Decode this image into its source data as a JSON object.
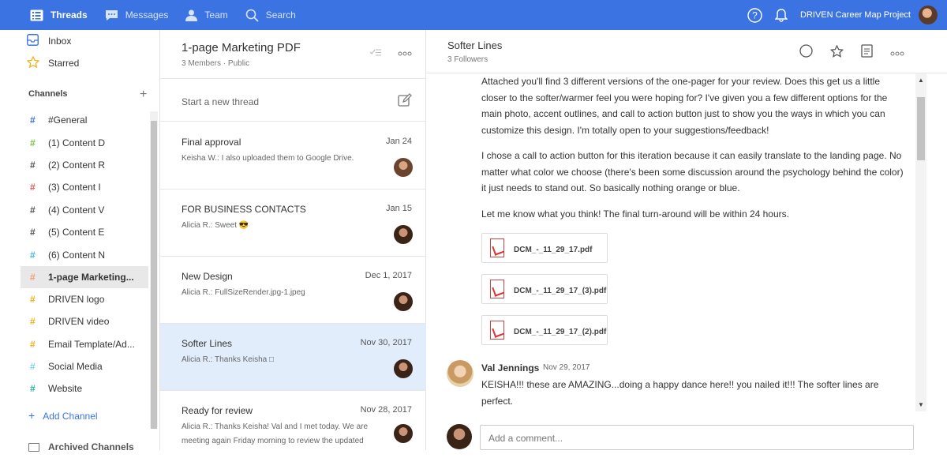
{
  "topbar": {
    "nav": [
      {
        "label": "Threads",
        "icon": "threads-icon"
      },
      {
        "label": "Messages",
        "icon": "messages-icon"
      },
      {
        "label": "Team",
        "icon": "team-icon"
      },
      {
        "label": "Search",
        "icon": "search-icon"
      }
    ],
    "project": "DRIVEN Career Map Project",
    "accent": "#3c73e2"
  },
  "sidebar": {
    "inbox": "Inbox",
    "starred": "Starred",
    "channels_heading": "Channels",
    "channels": [
      {
        "name": "#General",
        "color": "#3c73e2"
      },
      {
        "name": "(1) Content D",
        "color": "#7cc43c"
      },
      {
        "name": "(2) Content R",
        "color": "#555555"
      },
      {
        "name": "(3) Content I",
        "color": "#e05a5a"
      },
      {
        "name": "(4) Content V",
        "color": "#555555"
      },
      {
        "name": "(5) Content E",
        "color": "#555555"
      },
      {
        "name": "(6) Content N",
        "color": "#45b7e8"
      },
      {
        "name": "1-page Marketing...",
        "color": "#f0a070"
      },
      {
        "name": "DRIVEN logo",
        "color": "#f1b21b"
      },
      {
        "name": "DRIVEN video",
        "color": "#f1b21b"
      },
      {
        "name": "Email Template/Ad...",
        "color": "#f1b21b"
      },
      {
        "name": "Social Media",
        "color": "#7fd0ea"
      },
      {
        "name": "Website",
        "color": "#2bb3a0"
      }
    ],
    "add_channel": "Add Channel",
    "archived": "Archived Channels"
  },
  "threads": {
    "title": "1-page Marketing PDF",
    "subtitle": "3 Members · Public",
    "new_thread_placeholder": "Start a new thread",
    "items": [
      {
        "title": "Final approval",
        "date": "Jan 24",
        "preview": "Keisha W.: I also uploaded them to Google Drive."
      },
      {
        "title": "FOR BUSINESS CONTACTS",
        "date": "Jan 15",
        "preview": "Alicia R.: Sweet 😎"
      },
      {
        "title": "New Design",
        "date": "Dec 1, 2017",
        "preview": "Alicia R.: FullSizeRender.jpg-1.jpeg"
      },
      {
        "title": "Softer Lines",
        "date": "Nov 30, 2017",
        "preview": "Alicia R.: Thanks Keisha □"
      },
      {
        "title": "Ready for review",
        "date": "Nov 28, 2017",
        "preview": "Alicia R.: Thanks Keisha! Val and I met today. We are meeting again Friday morning to review the updated"
      }
    ]
  },
  "detail": {
    "title": "Softer Lines",
    "followers": "3 Followers",
    "paragraphs": [
      "Attached you'll find 3 different versions of the one-pager for your review. Does this get us a little closer to the softer/warmer feel you were hoping for? I've given you a few different options for the main photo, accent outlines, and call to action button just to show you the ways in which you can customize this design. I'm totally open to your suggestions/feedback!",
      "I chose a call to action button for this iteration because it can easily translate to the landing page. No matter what color we choose (there's been some discussion around the psychology behind the color) it just needs to stand out. So basically nothing orange or blue.",
      "Let me know what you think! The final turn-around will be within 24 hours."
    ],
    "files": [
      "DCM_-_11_29_17.pdf",
      "DCM_-_11_29_17_(3).pdf",
      "DCM_-_11_29_17_(2).pdf"
    ],
    "comment": {
      "author": "Val Jennings",
      "date": "Nov 29, 2017",
      "text": "KEISHA!!! these are AMAZING...doing a happy dance here!! you nailed it!!! The softer lines are perfect."
    },
    "composer_placeholder": "Add a comment..."
  }
}
